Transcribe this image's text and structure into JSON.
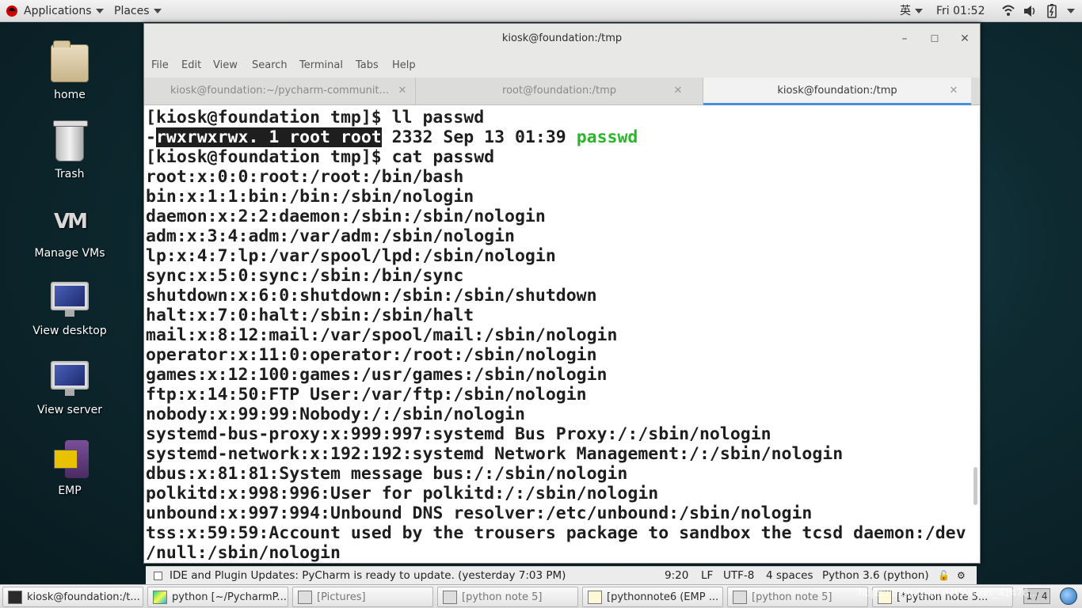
{
  "top_panel": {
    "applications": "Applications",
    "places": "Places",
    "input_method": "英",
    "clock": "Fri 01:52"
  },
  "desktop_icons": [
    {
      "label": "home",
      "icon": "home-folder-icon"
    },
    {
      "label": "Trash",
      "icon": "trash-icon"
    },
    {
      "label": "Manage VMs",
      "icon": "vm-icon"
    },
    {
      "label": "View desktop",
      "icon": "monitor-icon"
    },
    {
      "label": "View server",
      "icon": "monitor-icon"
    },
    {
      "label": "EMP",
      "icon": "emp-icon"
    }
  ],
  "window": {
    "title": "kiosk@foundation:/tmp",
    "menu": [
      "File",
      "Edit",
      "View",
      "Search",
      "Terminal",
      "Tabs",
      "Help"
    ],
    "tabs": [
      {
        "label": "kiosk@foundation:~/pycharm-communit...",
        "active": false
      },
      {
        "label": "root@foundation:/tmp",
        "active": false
      },
      {
        "label": "kiosk@foundation:/tmp",
        "active": true
      }
    ]
  },
  "terminal": {
    "line0": "[kiosk@foundation tmp]$ ll passwd",
    "perm_dash": "-",
    "perm_highlight": "rwxrwxrwx. 1 root root",
    "perm_rest": " 2332 Sep 13 01:39 ",
    "perm_file": "passwd",
    "lines": [
      "[kiosk@foundation tmp]$ cat passwd",
      "root:x:0:0:root:/root:/bin/bash",
      "bin:x:1:1:bin:/bin:/sbin/nologin",
      "daemon:x:2:2:daemon:/sbin:/sbin/nologin",
      "adm:x:3:4:adm:/var/adm:/sbin/nologin",
      "lp:x:4:7:lp:/var/spool/lpd:/sbin/nologin",
      "sync:x:5:0:sync:/sbin:/bin/sync",
      "shutdown:x:6:0:shutdown:/sbin:/sbin/shutdown",
      "halt:x:7:0:halt:/sbin:/sbin/halt",
      "mail:x:8:12:mail:/var/spool/mail:/sbin/nologin",
      "operator:x:11:0:operator:/root:/sbin/nologin",
      "games:x:12:100:games:/usr/games:/sbin/nologin",
      "ftp:x:14:50:FTP User:/var/ftp:/sbin/nologin",
      "nobody:x:99:99:Nobody:/:/sbin/nologin",
      "systemd-bus-proxy:x:999:997:systemd Bus Proxy:/:/sbin/nologin",
      "systemd-network:x:192:192:systemd Network Management:/:/sbin/nologin",
      "dbus:x:81:81:System message bus:/:/sbin/nologin",
      "polkitd:x:998:996:User for polkitd:/:/sbin/nologin",
      "unbound:x:997:994:Unbound DNS resolver:/etc/unbound:/sbin/nologin",
      "tss:x:59:59:Account used by the trousers package to sandbox the tcsd daemon:/dev",
      "/null:/sbin/nologin"
    ]
  },
  "status_strip": {
    "message": "IDE and Plugin Updates: PyCharm is ready to update. (yesterday 7:03 PM)",
    "position": "9:20",
    "line_sep": "LF",
    "encoding": "UTF-8",
    "indent": "4 spaces",
    "interpreter": "Python 3.6 (python)"
  },
  "taskbar": {
    "tasks": [
      {
        "label": "kiosk@foundation:/t...",
        "icon": "terminal-icon"
      },
      {
        "label": "python [~/PycharmP...",
        "icon": "pycharm-icon"
      },
      {
        "label": "[Pictures]",
        "icon": "folder-icon"
      },
      {
        "label": "[python note 5]",
        "icon": "folder-icon"
      },
      {
        "label": "[pythonnote6 (EMP ...",
        "icon": "document-icon"
      },
      {
        "label": "[python note 5]",
        "icon": "folder-icon"
      },
      {
        "label": "[*python note 5...",
        "icon": "document-icon"
      }
    ],
    "watermark": "https://blog.csdn.net/weixin_41476...",
    "workspace": "1 / 4"
  },
  "colors": {
    "tab_accent": "#4a90d9",
    "filename_green": "#2bb52b",
    "desktop_bg": "#0e2a31"
  }
}
